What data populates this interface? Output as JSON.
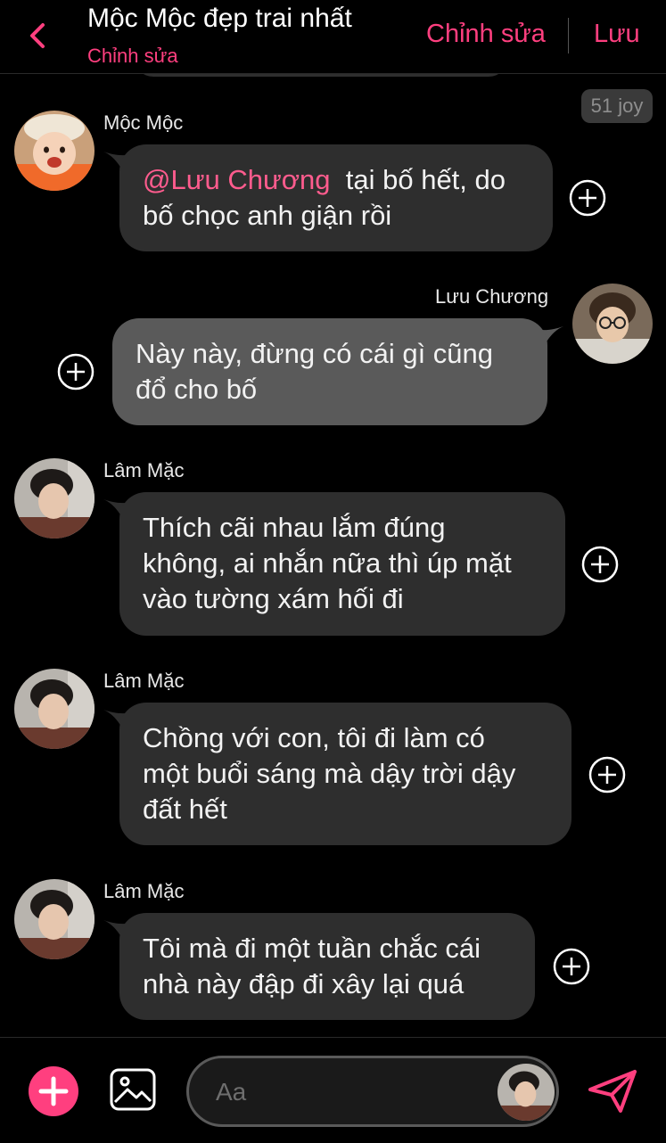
{
  "header": {
    "title": "Mộc Mộc đẹp trai nhất",
    "subtitle": "Chỉnh sửa",
    "edit_label": "Chỉnh sửa",
    "save_label": "Lưu",
    "accent": "#ff3f7f"
  },
  "joy_badge": "51 joy",
  "messages": [
    {
      "sender": "Mộc Mộc",
      "side": "left",
      "mention": "@Lưu Chương",
      "line1_rest": "tại bố hết, do",
      "line2": "bố chọc anh giận rồi"
    },
    {
      "sender": "Lưu Chương",
      "side": "right",
      "line1": "Này này, đừng có cái gì cũng",
      "line2": "đổ cho bố"
    },
    {
      "sender": "Lâm Mặc",
      "side": "left",
      "line1": "Thích cãi nhau lắm đúng",
      "line2": "không, ai nhắn nữa thì úp mặt",
      "line3": "vào tường xám hối đi"
    },
    {
      "sender": "Lâm Mặc",
      "side": "left",
      "line1": "Chồng với con, tôi đi làm có",
      "line2": "một buổi sáng mà dậy trời dậy",
      "line3": "đất hết"
    },
    {
      "sender": "Lâm Mặc",
      "side": "left",
      "line1": "Tôi mà đi một tuần chắc cái",
      "line2": "nhà này đập đi xây lại quá"
    }
  ],
  "composer": {
    "placeholder": "Aa"
  },
  "icons": {
    "back": "chevron-left-icon",
    "add": "plus-icon",
    "image": "image-icon",
    "send": "send-icon",
    "react": "add-circle-icon"
  }
}
